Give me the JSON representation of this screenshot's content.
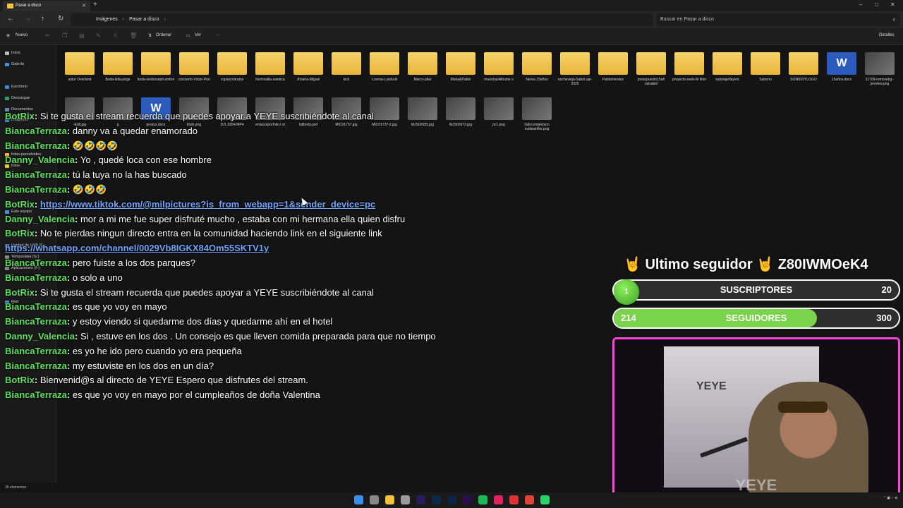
{
  "window": {
    "tab_title": "Pasar a disco",
    "new_tab": "+",
    "controls": {
      "minimize": "–",
      "maximize": "□",
      "close": "✕"
    }
  },
  "address": {
    "crumbs": [
      "Imágenes",
      "Pasar a disco"
    ],
    "search_placeholder": "Buscar en Pasar a disco"
  },
  "commands": {
    "new": "Nuevo",
    "sort": "Ordenar",
    "view": "Ver",
    "more": "···",
    "details": "Detalles"
  },
  "sidebar": {
    "items": [
      "Inicio",
      "Galería",
      "Escritorio",
      "Descargas",
      "Documentos",
      "Imágenes",
      "fotos-pareelvideo",
      "fotos",
      "Este equipo",
      "Unidad de USB (E:",
      "Temporales (G:)",
      "Aplicaciones (F:)",
      "Red"
    ]
  },
  "files_row1": [
    {
      "name": "astur Overland",
      "kind": "folder"
    },
    {
      "name": "Boda-lidia-jorge",
      "kind": "folder"
    },
    {
      "name": "boda-nestorsepti embre",
      "kind": "folder"
    },
    {
      "name": "concierto-Victor-Puri",
      "kind": "folder"
    },
    {
      "name": "copiacontratos",
      "kind": "folder"
    },
    {
      "name": "hermosilla estetica",
      "kind": "folder"
    },
    {
      "name": "Jhoana-Miguel",
      "kind": "folder"
    },
    {
      "name": "kick",
      "kind": "folder"
    },
    {
      "name": "Lorena-LuisKolli",
      "kind": "folder"
    },
    {
      "name": "Marco-pilar",
      "kind": "folder"
    },
    {
      "name": "Maria&Pablo",
      "kind": "folder"
    },
    {
      "name": "muestrasAlbume s",
      "kind": "folder"
    },
    {
      "name": "Nerea 15años",
      "kind": "folder"
    },
    {
      "name": "nocheviejа-Sabot aje-2025",
      "kind": "folder"
    },
    {
      "name": "Pablomendez",
      "kind": "folder"
    },
    {
      "name": "presupuesto15añ osisabel",
      "kind": "folder"
    },
    {
      "name": "proyecto-reels-M ilton",
      "kind": "folder"
    },
    {
      "name": "sabotajeflayers",
      "kind": "folder"
    },
    {
      "name": "Saturno",
      "kind": "folder"
    },
    {
      "name": "SONIDOYLOGO",
      "kind": "folder"
    },
    {
      "name": "15años.docx",
      "kind": "doc"
    },
    {
      "name": "21709-removebg -preview.png",
      "kind": "img"
    }
  ],
  "files_row2": [
    {
      "name": "-Edit.jpg",
      "kind": "img"
    },
    {
      "name": "g",
      "kind": "img"
    },
    {
      "name": "presus.docx",
      "kind": "doc"
    },
    {
      "name": "titulo.png",
      "kind": "img"
    },
    {
      "name": "DJI_0354.MP4",
      "kind": "img"
    },
    {
      "name": "enlacesporfolio.t xt",
      "kind": "img"
    },
    {
      "name": "fullbody.psd",
      "kind": "img"
    },
    {
      "name": "MIC01737.jpg",
      "kind": "img"
    },
    {
      "name": "MIC01737-2.jpg",
      "kind": "img"
    },
    {
      "name": "MJS02655.jpg",
      "kind": "img"
    },
    {
      "name": "MJS02673.jpg",
      "kind": "img"
    },
    {
      "name": "pc1.png",
      "kind": "img"
    },
    {
      "name": "todocompletoco nvidesinfler.png",
      "kind": "img"
    }
  ],
  "status": {
    "count": "35 elementos"
  },
  "chat": [
    {
      "user": "BotRix",
      "text": "Si te gusta el stream recuerda que puedes apoyar a YEYE suscribiéndote al canal"
    },
    {
      "user": "BiancaTerraza",
      "text": "danny va a quedar enamorado"
    },
    {
      "user": "BiancaTerraza",
      "text": "🤣🤣🤣🤣"
    },
    {
      "user": "Danny_Valencia",
      "text": "Yo , quedé loca con ese hombre"
    },
    {
      "user": "BiancaTerraza",
      "text": "tú la tuya no la has buscado"
    },
    {
      "user": "BiancaTerraza",
      "text": "🤣🤣🤣"
    },
    {
      "user": "BotRix",
      "link": "https://www.tiktok.com/@milpictures?is_from_webapp=1&sender_device=pc"
    },
    {
      "user": "Danny_Valencia",
      "text": "mor a mi me fue super disfruté mucho , estaba con mi hermana ella quien disfru"
    },
    {
      "user": "BotRix",
      "text": "No te pierdas ningun directo entra en la comunidad haciendo link en el siguiente link",
      "link2": "https://whatsapp.com/channel/0029Vb8IGKX84Om55SKTV1y"
    },
    {
      "user": "BiancaTerraza",
      "text": "pero fuiste a los dos parques?"
    },
    {
      "user": "BiancaTerraza",
      "text": "o solo a uno"
    },
    {
      "user": "BotRix",
      "text": "Si te gusta el stream recuerda que puedes apoyar a YEYE suscribiéndote al canal"
    },
    {
      "user": "BiancaTerraza",
      "text": "es que yo voy en mayo"
    },
    {
      "user": "BiancaTerraza",
      "text": "y estoy viendo si quedarme dos días y quedarme ahí en el hotel"
    },
    {
      "user": "Danny_Valencia",
      "text": "Si , estuve en los dos . Un consejo es que lleven comida preparada para que no tiempo"
    },
    {
      "user": "BiancaTerraza",
      "text": "es yo he ido pero cuando yo era pequeña"
    },
    {
      "user": "BiancaTerraza",
      "text": "my estuviste en los dos en un día?"
    },
    {
      "user": "BotRix",
      "text": "Bienvenid@s al directo de YEYE Espero que disfrutes del stream."
    },
    {
      "user": "BiancaTerraza",
      "text": "es que yo voy en mayo por el cumpleaños de doña Valentina"
    }
  ],
  "widgets": {
    "last_follower": "🤘 Ultimo seguidor 🤘 Z80IWMOeK4",
    "subs": {
      "label": "SUSCRIPTORES",
      "current": "1",
      "goal": "20",
      "progress": 0.05
    },
    "followers": {
      "label": "SEGUIDORES",
      "current": "214",
      "goal": "300",
      "progress": 0.713
    }
  },
  "webcam": {
    "wall_logo": "YEYE",
    "watermark": "YEYE"
  },
  "taskbar": {
    "icons": [
      {
        "name": "start",
        "color": "#3b8eea"
      },
      {
        "name": "search",
        "color": "#888888"
      },
      {
        "name": "file-explorer",
        "color": "#f3c13a"
      },
      {
        "name": "chrome",
        "color": "#9a9a9a"
      },
      {
        "name": "after-effects",
        "color": "#2b1b5a"
      },
      {
        "name": "lightroom",
        "color": "#0b2a4a"
      },
      {
        "name": "photoshop",
        "color": "#0f2440"
      },
      {
        "name": "premiere",
        "color": "#2a0f4a"
      },
      {
        "name": "spotify",
        "color": "#1db954"
      },
      {
        "name": "tiktok",
        "color": "#e0245e"
      },
      {
        "name": "app-red",
        "color": "#d33"
      },
      {
        "name": "chrome2",
        "color": "#dd4433"
      },
      {
        "name": "whatsapp",
        "color": "#25d366"
      }
    ]
  }
}
